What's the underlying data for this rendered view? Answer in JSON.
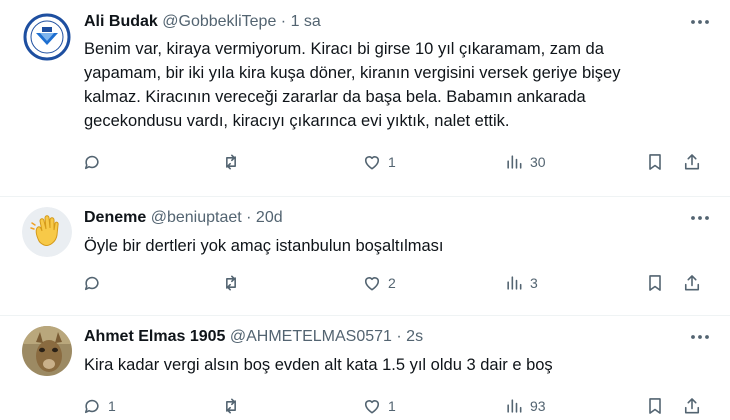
{
  "tweets": [
    {
      "name": "Ali Budak",
      "handle": "@GobbekliTepe",
      "time": "· 1 sa",
      "avatar": "university-seal",
      "lines": [
        "Benim var, kiraya vermiyorum. Kiracı bi girse 10 yıl çıkaramam, zam da",
        "yapamam, bir iki yıla kira kuşa döner, kiranın vergisini versek geriye bişey",
        "kalmaz. Kiracının vereceği zararlar da başa bela. Babamın ankarada",
        "gecekondusu vardı, kiracıyı çıkarınca evi yıktık, nalet ettik."
      ],
      "replies": "",
      "retweets": "",
      "likes": "1",
      "views": "30"
    },
    {
      "name": "Deneme",
      "handle": "@beniuptaet",
      "time": "· 20d",
      "avatar": "waving-hand",
      "lines": [
        "Öyle bir dertleri yok amaç istanbulun boşaltılması"
      ],
      "replies": "",
      "retweets": "",
      "likes": "2",
      "views": "3"
    },
    {
      "name": "Ahmet Elmas 1905",
      "handle": "@AHMETELMAS0571",
      "time": "· 2s",
      "avatar": "animal-photo",
      "lines": [
        "Kira kadar vergi alsın boş evden alt kata 1.5 yıl oldu 3 dair e boş"
      ],
      "replies": "1",
      "retweets": "",
      "likes": "1",
      "views": "93"
    }
  ],
  "colors": {
    "text": "#0f1419",
    "secondary": "#536471",
    "border": "#eff3f4"
  }
}
